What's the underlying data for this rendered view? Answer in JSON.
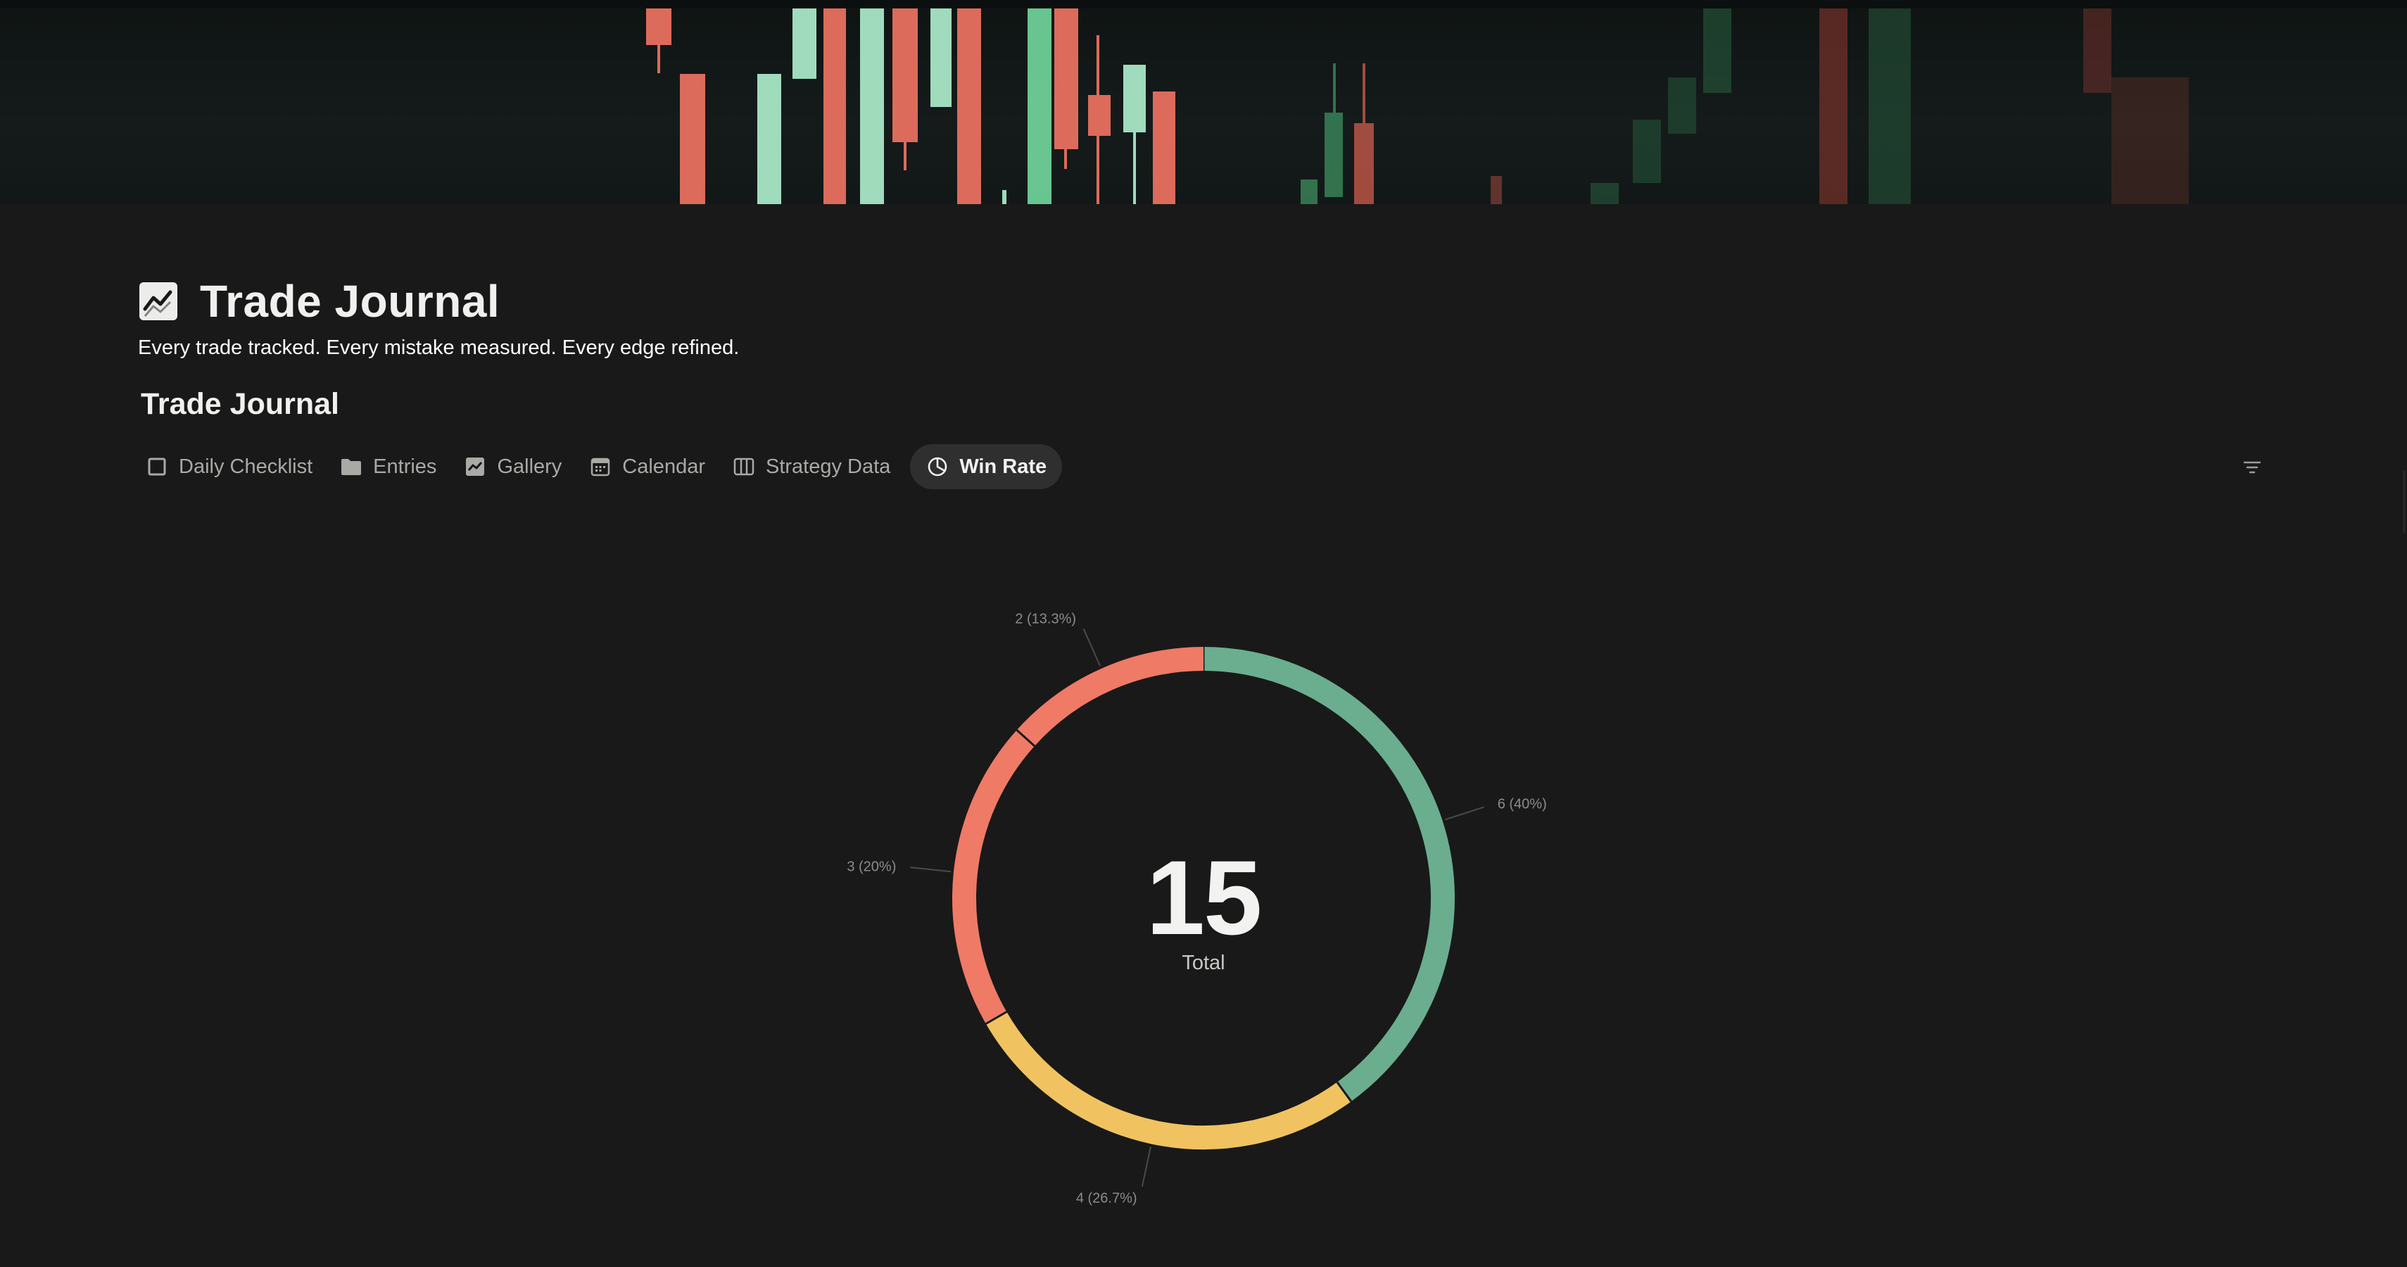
{
  "page": {
    "title": "Trade Journal",
    "subtitle": "Every trade tracked. Every mistake measured. Every edge refined."
  },
  "icons": {
    "page_icon": "chart-line-icon",
    "filter": "filter-icon"
  },
  "database": {
    "title": "Trade Journal",
    "tabs": [
      {
        "label": "Daily Checklist",
        "icon": "checkbox-icon",
        "active": false
      },
      {
        "label": "Entries",
        "icon": "folder-icon",
        "active": false
      },
      {
        "label": "Gallery",
        "icon": "chart-line-icon",
        "active": false
      },
      {
        "label": "Calendar",
        "icon": "calendar-icon",
        "active": false
      },
      {
        "label": "Strategy Data",
        "icon": "columns-icon",
        "active": false
      },
      {
        "label": "Win Rate",
        "icon": "pie-chart-icon",
        "active": true
      }
    ]
  },
  "colors": {
    "green": "#6aae8f",
    "yellow": "#f0c360",
    "red": "#ef7a66",
    "background": "#191919"
  },
  "chart_data": {
    "type": "pie",
    "donut": true,
    "center_value": "15",
    "center_label": "Total",
    "slices": [
      {
        "value": 6,
        "label": "6 (40%)",
        "color": "#6aae8f"
      },
      {
        "value": 4,
        "label": "4 (26.7%)",
        "color": "#f0c360"
      },
      {
        "value": 3,
        "label": "3 (20%)",
        "color": "#ef7a66"
      },
      {
        "value": 2,
        "label": "2 (13.3%)",
        "color": "#ef7a66"
      }
    ]
  }
}
